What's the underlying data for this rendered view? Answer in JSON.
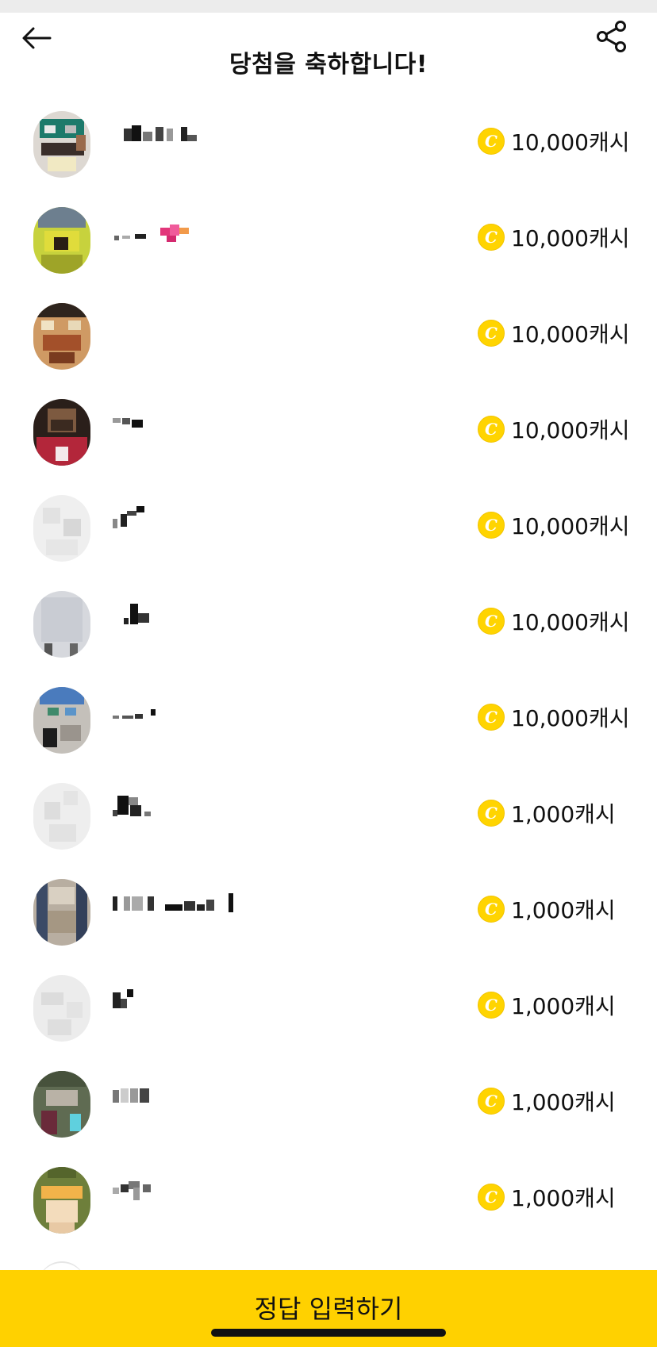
{
  "header": {
    "title": "당첨을 축하합니다!",
    "back_icon": "back-arrow-icon",
    "share_icon": "share-icon"
  },
  "coin": {
    "symbol": "C",
    "icon": "coin-icon",
    "color": "#ffd400"
  },
  "winners": [
    {
      "reward": "10,000캐시",
      "name_blurred": true
    },
    {
      "reward": "10,000캐시",
      "name_blurred": true
    },
    {
      "reward": "10,000캐시",
      "name_blurred": true
    },
    {
      "reward": "10,000캐시",
      "name_blurred": true
    },
    {
      "reward": "10,000캐시",
      "name_blurred": true
    },
    {
      "reward": "10,000캐시",
      "name_blurred": true
    },
    {
      "reward": "10,000캐시",
      "name_blurred": true
    },
    {
      "reward": "1,000캐시",
      "name_blurred": true
    },
    {
      "reward": "1,000캐시",
      "name_blurred": true
    },
    {
      "reward": "1,000캐시",
      "name_blurred": true
    },
    {
      "reward": "1,000캐시",
      "name_blurred": true
    },
    {
      "reward": "1,000캐시",
      "name_blurred": true
    }
  ],
  "submit_button": {
    "label": "정답 입력하기",
    "color": "#ffd100"
  }
}
